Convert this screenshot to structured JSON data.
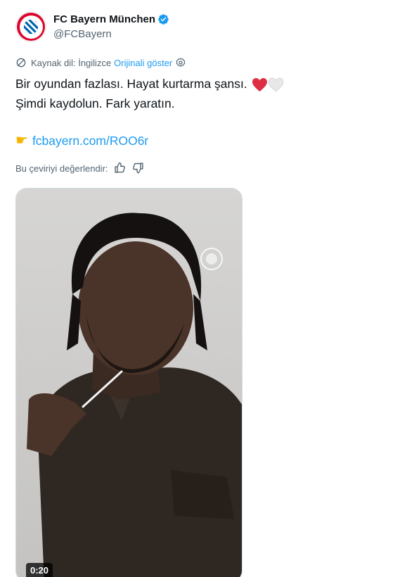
{
  "account": {
    "name": "FC Bayern München",
    "handle": "@FCBayern",
    "avatar_icon": "fc-bayern-crest",
    "verified_icon": "verified-badge-icon",
    "verified_color": "#1d9bf0"
  },
  "translation": {
    "source_label": "Kaynak dil: İngilizce",
    "show_original": "Orijinali göster"
  },
  "tweet": {
    "line1": "Bir oyundan fazlası. Hayat kurtarma şansı.",
    "line2": "Şimdi kaydolun. Fark yaratın.",
    "link_icon": "pointing-right-hand",
    "link": "fcbayern.com/ROO6r",
    "link_color": "#1d9bf0"
  },
  "rating": {
    "label": "Bu çeviriyi değerlendir:"
  },
  "media": {
    "duration": "0:20"
  }
}
